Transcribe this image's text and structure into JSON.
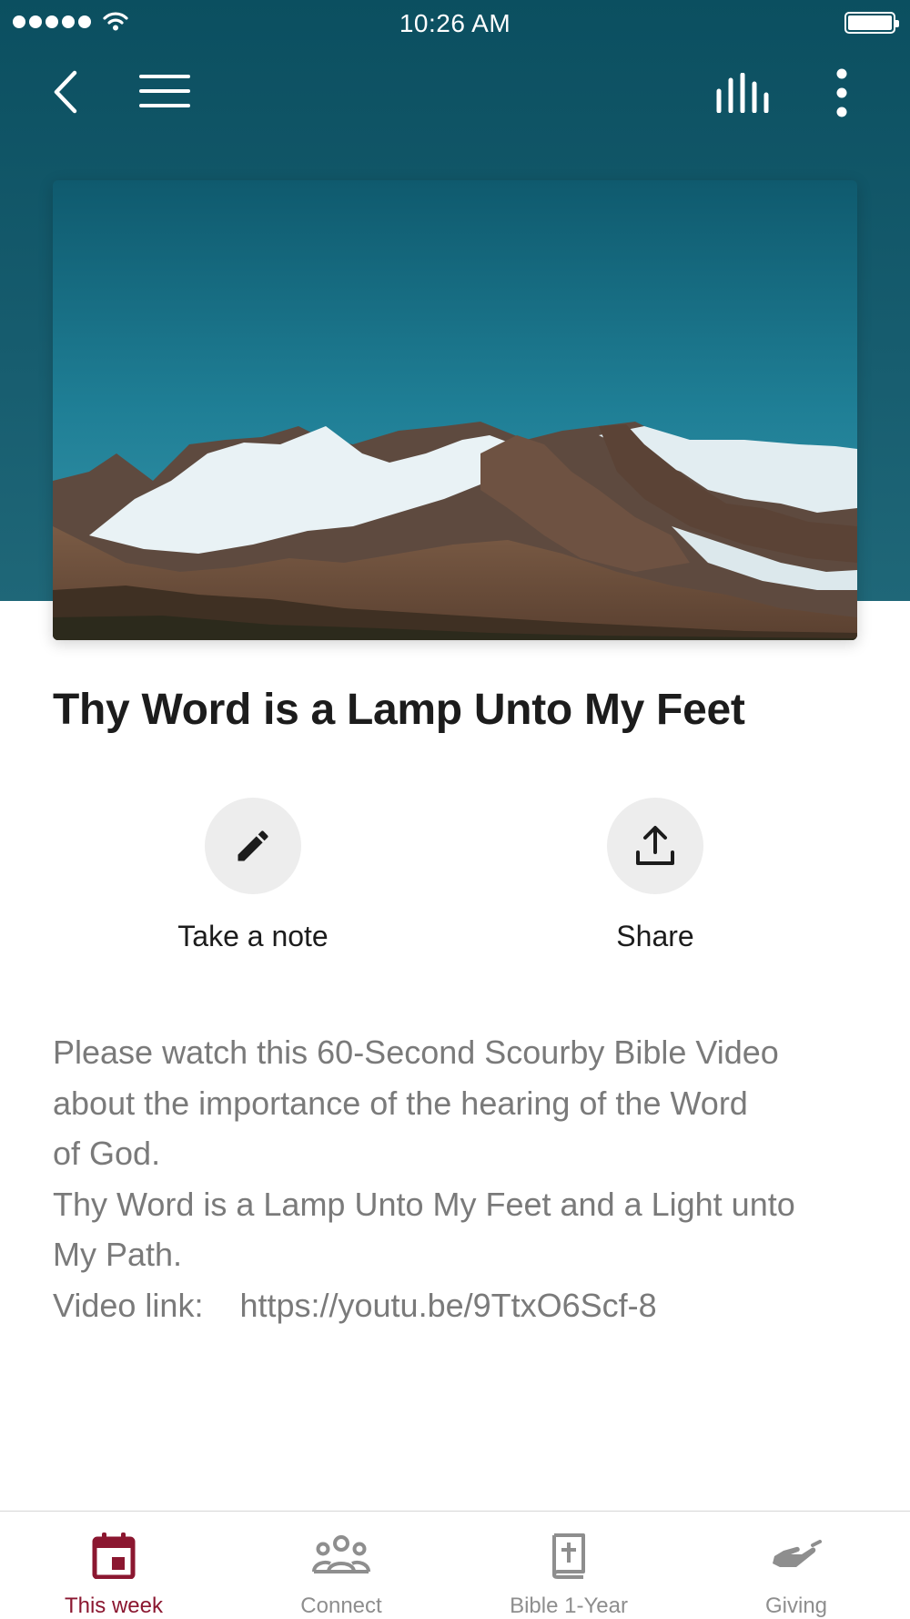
{
  "status_bar": {
    "time": "10:26 AM",
    "icons": [
      "signal-dots-icon",
      "wifi-icon",
      "battery-icon"
    ]
  },
  "nav": {
    "icons": [
      "back-chevron-icon",
      "hamburger-menu-icon",
      "audio-bars-icon",
      "vertical-dots-icon"
    ]
  },
  "hero": {
    "image": "mountain-landscape"
  },
  "content": {
    "title": "Thy Word is a Lamp Unto My Feet",
    "actions": [
      {
        "label": "Take a note",
        "icon": "pencil-icon"
      },
      {
        "label": "Share",
        "icon": "share-upload-icon"
      }
    ],
    "body": {
      "line1": "Please watch this 60-Second Scourby Bible Video",
      "line2": "about the importance of the hearing of the Word",
      "line3": "of God.",
      "line4": "Thy Word is a Lamp Unto My Feet and a Light unto",
      "line5": "My Path.",
      "video_label": "Video link:",
      "video_url": "https://youtu.be/9TtxO6Scf-8"
    }
  },
  "tab_bar": {
    "active_color": "#8b1730",
    "inactive_color": "#8e8e8e",
    "tabs": [
      {
        "label": "This week",
        "icon": "calendar-icon",
        "active": true
      },
      {
        "label": "Connect",
        "icon": "people-group-icon",
        "active": false
      },
      {
        "label": "Bible 1-Year",
        "icon": "bible-cross-icon",
        "active": false
      },
      {
        "label": "Giving",
        "icon": "giving-hand-icon",
        "active": false
      }
    ]
  }
}
